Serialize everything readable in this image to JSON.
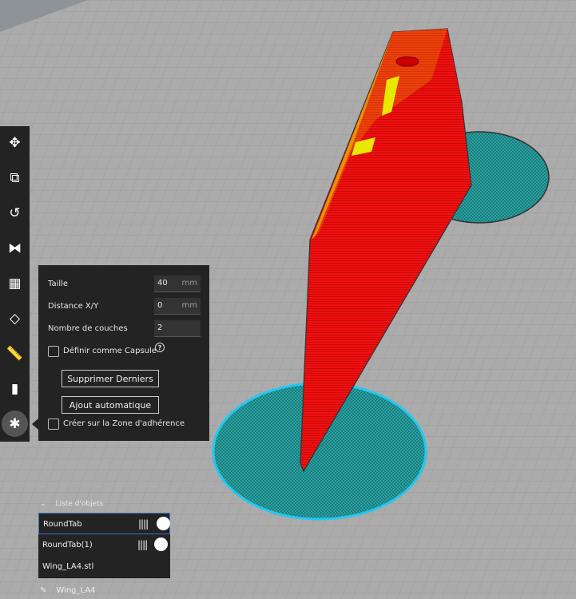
{
  "toolbar": {
    "tools": [
      {
        "icon": "move-icon",
        "glyph": "✥"
      },
      {
        "icon": "scale-icon",
        "glyph": "⧉"
      },
      {
        "icon": "rotate-icon",
        "glyph": "↺"
      },
      {
        "icon": "mirror-icon",
        "glyph": "⧓"
      },
      {
        "icon": "per-model-settings-icon",
        "glyph": "▦"
      },
      {
        "icon": "support-blocker-icon",
        "glyph": "◇"
      },
      {
        "icon": "measure-icon",
        "glyph": "📏"
      },
      {
        "icon": "cylinder-icon",
        "glyph": "▮"
      },
      {
        "icon": "tab-plus-icon",
        "glyph": "✱"
      }
    ]
  },
  "panel": {
    "size_label": "Taille",
    "size_value": "40",
    "size_unit": "mm",
    "distance_label": "Distance X/Y",
    "distance_value": "0",
    "distance_unit": "mm",
    "layers_label": "Nombre de couches",
    "layers_value": "2",
    "capsule_label": "Définir comme Capsule",
    "capsule_checked": false,
    "help_glyph": "?",
    "remove_last_label": "Supprimer Derniers",
    "auto_add_label": "Ajout automatique",
    "adhesion_label": "Créer sur la Zone d'adhérence",
    "adhesion_checked": false
  },
  "object_list": {
    "title": "Liste d'objets",
    "chevron": "⌄",
    "items": [
      {
        "name": "RoundTab",
        "selected": true
      },
      {
        "name": "RoundTab(1)",
        "selected": false
      },
      {
        "name": "Wing_LA4.stl",
        "selected": false
      }
    ],
    "extruder_glyph": "||||"
  },
  "footer": {
    "pencil_glyph": "✎",
    "job_name": "Wing_LA4"
  },
  "colors": {
    "model": "#ee1111",
    "overhang": "#e8e800",
    "tab": "#2aa3a3",
    "tab_outline": "#22c8f0",
    "panel_bg": "#232323"
  }
}
